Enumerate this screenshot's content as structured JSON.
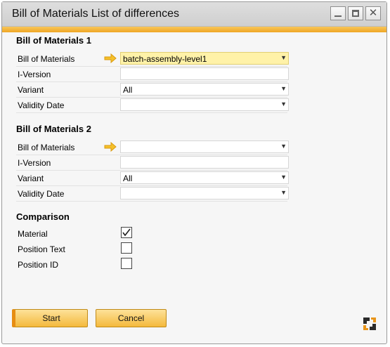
{
  "window": {
    "title": "Bill of Materials List of differences"
  },
  "section1": {
    "title": "Bill of Materials 1",
    "rows": [
      {
        "label": "Bill of Materials",
        "value": "batch-assembly-level1"
      },
      {
        "label": "I-Version",
        "value": ""
      },
      {
        "label": "Variant",
        "value": "All"
      },
      {
        "label": "Validity Date",
        "value": ""
      }
    ]
  },
  "section2": {
    "title": "Bill of Materials 2",
    "rows": [
      {
        "label": "Bill of Materials",
        "value": ""
      },
      {
        "label": "I-Version",
        "value": ""
      },
      {
        "label": "Variant",
        "value": "All"
      },
      {
        "label": "Validity Date",
        "value": ""
      }
    ]
  },
  "comparison": {
    "title": "Comparison",
    "items": [
      {
        "label": "Material",
        "checked": true
      },
      {
        "label": "Position Text",
        "checked": false
      },
      {
        "label": "Position ID",
        "checked": false
      }
    ]
  },
  "buttons": {
    "start": "Start",
    "cancel": "Cancel"
  },
  "colors": {
    "accent": "#f0a624",
    "highlight": "#fff2a8",
    "arrow": "#f0b220"
  },
  "icons": {
    "link_arrow": "link-arrow-icon",
    "checkmark": "checkmark-icon",
    "brand": "sap-logo-icon"
  }
}
